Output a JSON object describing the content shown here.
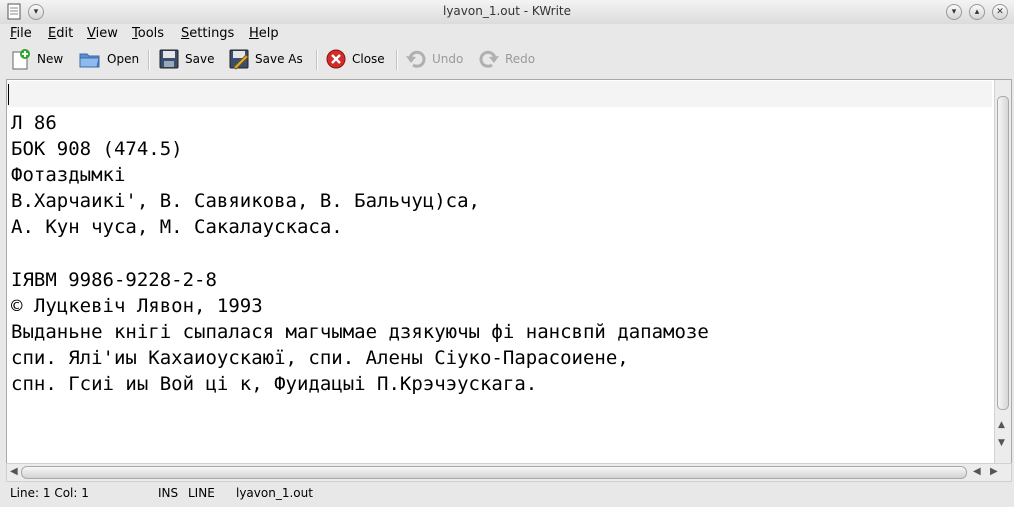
{
  "window": {
    "title": "lyavon_1.out - KWrite",
    "title_icon": "document-icon",
    "controls": [
      "minimize-icon",
      "maximize-icon",
      "close-icon"
    ]
  },
  "menu": [
    {
      "label": "File",
      "mnemonic": "F",
      "rest": "ile"
    },
    {
      "label": "Edit",
      "mnemonic": "E",
      "rest": "dit"
    },
    {
      "label": "View",
      "mnemonic": "V",
      "rest": "iew"
    },
    {
      "label": "Tools",
      "mnemonic": "T",
      "rest": "ools"
    },
    {
      "label": "Settings",
      "mnemonic": "S",
      "rest": "ettings"
    },
    {
      "label": "Help",
      "mnemonic": "H",
      "rest": "elp"
    }
  ],
  "toolbar": {
    "new": "New",
    "open": "Open",
    "save": "Save",
    "save_as": "Save As",
    "close": "Close",
    "undo": "Undo",
    "redo": "Redo"
  },
  "editor": {
    "lines": [
      "",
      "Л 86",
      "БОК 908 (474.5)",
      "Фотаздымкі",
      "В.Харчаикі', В. Савяикова, В. Бальчуц)са,",
      "А. Кун чуса, М. Сакалаускаса.",
      "",
      "IЯBM 9986-9228-2-8",
      "© Луцкевіч Лявон, 1993",
      "Выданьне кнігі сыпалася магчымае дзякуючы фі нансвпй дапамозе",
      "спи. Ялі'иы Кахаиоускаюї, спи. Алены Сіуко-Парасоиене,",
      "спн. Гсиі иы Вой ці к, Фуидацыі П.Крэчэускага."
    ]
  },
  "status": {
    "position": "Line: 1 Col: 1",
    "mode": "INS",
    "selection_mode": "LINE",
    "filename": "lyavon_1.out"
  }
}
